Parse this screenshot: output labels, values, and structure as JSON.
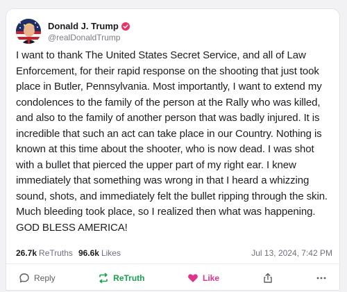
{
  "post": {
    "author": {
      "display_name": "Donald J. Trump",
      "handle": "@realDonaldTrump",
      "verified": true
    },
    "body": "I want to thank The United States Secret Service, and all of Law Enforcement, for their rapid response on the shooting that just took place in Butler, Pennsylvania. Most importantly, I want to extend my condolences to the family of the person at the Rally who was killed, and also to the family of another person that was badly injured. It is incredible that such an act can take place in our Country. Nothing is known at this time about the shooter, who is now dead. I was shot with a bullet that pierced the upper part of my right ear. I knew immediately that something was wrong in that I heard a whizzing sound, shots, and immediately felt the bullet ripping through the skin. Much bleeding took place, so I realized then what was happening. GOD BLESS AMERICA!",
    "stats": {
      "retruths_count": "26.7k",
      "retruths_label": "ReTruths",
      "likes_count": "96.6k",
      "likes_label": "Likes"
    },
    "timestamp": "Jul 13, 2024, 7:42 PM"
  },
  "actions": {
    "reply_label": "Reply",
    "retruth_label": "ReTruth",
    "like_label": "Like"
  },
  "colors": {
    "retruth_green": "#17a24d",
    "like_pink": "#e0348a",
    "verified_badge": "#e8336b"
  },
  "icons": {
    "reply": "chat-bubble-icon",
    "retruth": "repost-arrows-icon",
    "like": "heart-icon",
    "share": "share-upload-icon",
    "more": "more-dots-icon",
    "verified": "verified-badge-icon"
  }
}
